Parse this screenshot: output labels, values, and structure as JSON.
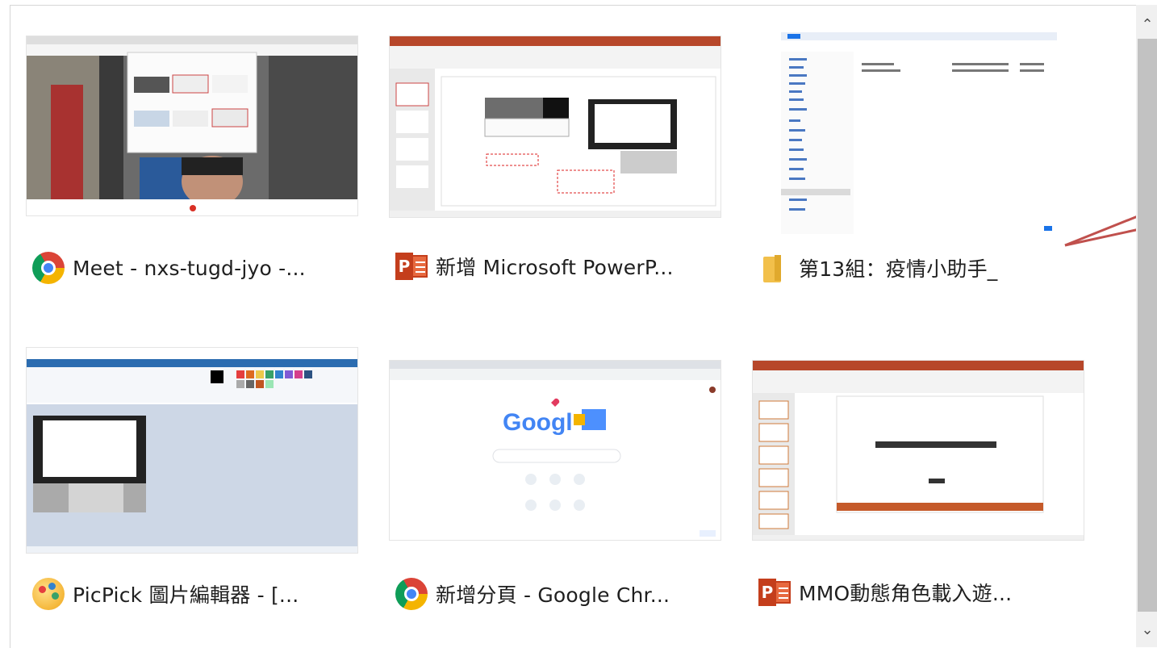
{
  "windows": [
    {
      "title": "Meet - nxs-tugd-jyo -...",
      "icon": "chrome-icon"
    },
    {
      "title": "新增 Microsoft PowerP...",
      "icon": "powerpoint-icon"
    },
    {
      "title": "第13組：疫情小助手_",
      "icon": "folder-icon"
    },
    {
      "title": "PicPick 圖片編輯器 - [...",
      "icon": "picpick-icon"
    },
    {
      "title": "新增分頁 - Google Chr...",
      "icon": "chrome-icon"
    },
    {
      "title": "MMO動態角色載入遊...",
      "icon": "powerpoint-icon"
    }
  ],
  "thumbs": {
    "google_logo": "Googl"
  },
  "scrollbar": {
    "up": "⌃",
    "down": "⌄"
  },
  "colors": {
    "annotation_line": "#c0504d",
    "scroll_thumb": "#c2c2c2"
  }
}
